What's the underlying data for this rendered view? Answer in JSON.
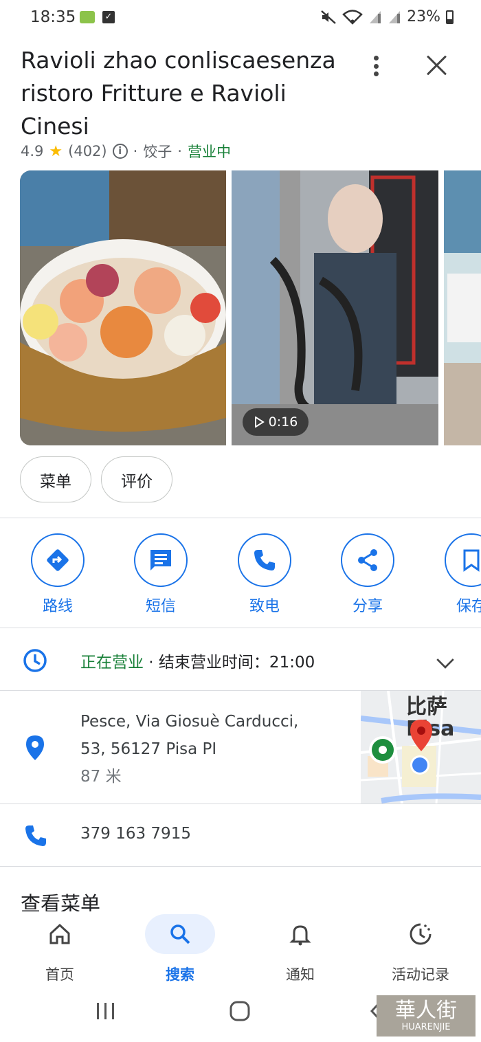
{
  "status_bar": {
    "time": "18:35",
    "battery": "23%"
  },
  "place": {
    "title": "Ravioli zhao conliscaesenza ristoro Fritture e Ravioli Cinesi",
    "rating": "4.9",
    "reviews": "(402)",
    "category": "饺子",
    "open_status": "营业中"
  },
  "photos": {
    "video_duration": "0:16"
  },
  "chips": [
    "菜单",
    "评价"
  ],
  "actions": {
    "route": "路线",
    "sms": "短信",
    "call": "致电",
    "share": "分享",
    "save": "保存"
  },
  "hours": {
    "open_now": "正在营业",
    "closing_text": " · 结束营业时间：21:00"
  },
  "address": {
    "line1": "Pesce, Via Giosuè Carducci,",
    "line2": "53, 56127 Pisa PI",
    "distance": "87 米",
    "map_label_1": "比萨",
    "map_label_2": "Pisa"
  },
  "phone": "379 163 7915",
  "menu_section_title": "查看菜单",
  "bottom_nav": {
    "home": "首页",
    "search": "搜索",
    "notifications": "通知",
    "activity": "活动记录"
  },
  "watermark": {
    "chars": "華人街",
    "latin": "HUARENJIE"
  },
  "colors": {
    "accent": "#1a73e8",
    "open_green": "#188038",
    "star": "#fbbc04"
  }
}
